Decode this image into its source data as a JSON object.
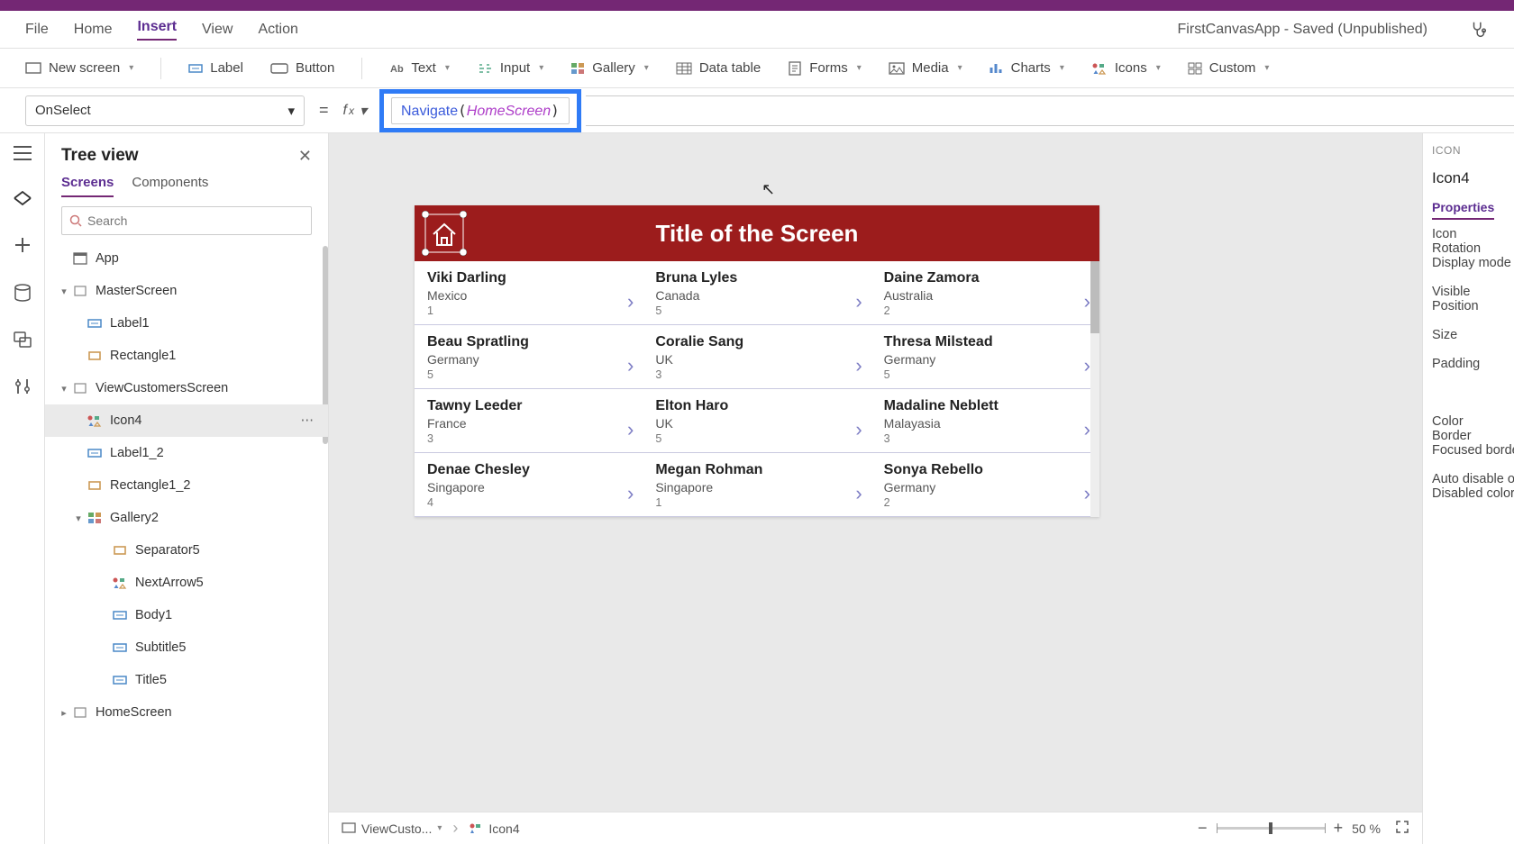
{
  "app_status": "FirstCanvasApp - Saved (Unpublished)",
  "menubar": {
    "items": [
      "File",
      "Home",
      "Insert",
      "View",
      "Action"
    ],
    "active_index": 2
  },
  "ribbon": {
    "groups": [
      {
        "label": "New screen",
        "has_chev": true,
        "icon": "screen"
      },
      {
        "sep": true
      },
      {
        "label": "Label",
        "icon": "label"
      },
      {
        "label": "Button",
        "icon": "button"
      },
      {
        "sep": true
      },
      {
        "label": "Text",
        "has_chev": true,
        "icon": "text"
      },
      {
        "label": "Input",
        "has_chev": true,
        "icon": "input"
      },
      {
        "label": "Gallery",
        "has_chev": true,
        "icon": "gallery"
      },
      {
        "label": "Data table",
        "icon": "datatable"
      },
      {
        "label": "Forms",
        "has_chev": true,
        "icon": "forms"
      },
      {
        "label": "Media",
        "has_chev": true,
        "icon": "media"
      },
      {
        "label": "Charts",
        "has_chev": true,
        "icon": "charts"
      },
      {
        "label": "Icons",
        "has_chev": true,
        "icon": "icons"
      },
      {
        "label": "Custom",
        "has_chev": true,
        "icon": "custom"
      }
    ]
  },
  "formula": {
    "property": "OnSelect",
    "fn": "Navigate",
    "arg": "HomeScreen"
  },
  "tree": {
    "title": "Tree view",
    "tabs": [
      "Screens",
      "Components"
    ],
    "active_tab": 0,
    "search_placeholder": "Search",
    "nodes": [
      {
        "indent": 0,
        "label": "App",
        "icon": "app",
        "twisty": ""
      },
      {
        "indent": 0,
        "label": "MasterScreen",
        "icon": "screen",
        "twisty": "▾",
        "check": true
      },
      {
        "indent": 1,
        "label": "Label1",
        "icon": "label"
      },
      {
        "indent": 1,
        "label": "Rectangle1",
        "icon": "rect"
      },
      {
        "indent": 0,
        "label": "ViewCustomersScreen",
        "icon": "screen",
        "twisty": "▾",
        "check": true
      },
      {
        "indent": 1,
        "label": "Icon4",
        "icon": "icons",
        "selected": true,
        "more": true
      },
      {
        "indent": 1,
        "label": "Label1_2",
        "icon": "label"
      },
      {
        "indent": 1,
        "label": "Rectangle1_2",
        "icon": "rect"
      },
      {
        "indent": 1,
        "label": "Gallery2",
        "icon": "gallery",
        "twisty": "▾"
      },
      {
        "indent": 2,
        "label": "Separator5",
        "icon": "rect"
      },
      {
        "indent": 2,
        "label": "NextArrow5",
        "icon": "icons"
      },
      {
        "indent": 2,
        "label": "Body1",
        "icon": "label"
      },
      {
        "indent": 2,
        "label": "Subtitle5",
        "icon": "label"
      },
      {
        "indent": 2,
        "label": "Title5",
        "icon": "label"
      },
      {
        "indent": 0,
        "label": "HomeScreen",
        "icon": "screen",
        "twisty": "▸",
        "check": true
      }
    ]
  },
  "canvas": {
    "screen_title": "Title of the Screen",
    "gallery": [
      [
        {
          "name": "Viki  Darling",
          "country": "Mexico",
          "n": "1"
        },
        {
          "name": "Bruna  Lyles",
          "country": "Canada",
          "n": "5"
        },
        {
          "name": "Daine  Zamora",
          "country": "Australia",
          "n": "2"
        }
      ],
      [
        {
          "name": "Beau  Spratling",
          "country": "Germany",
          "n": "5"
        },
        {
          "name": "Coralie  Sang",
          "country": "UK",
          "n": "3"
        },
        {
          "name": "Thresa  Milstead",
          "country": "Germany",
          "n": "5"
        }
      ],
      [
        {
          "name": "Tawny  Leeder",
          "country": "France",
          "n": "3"
        },
        {
          "name": "Elton  Haro",
          "country": "UK",
          "n": "5"
        },
        {
          "name": "Madaline  Neblett",
          "country": "Malayasia",
          "n": "3"
        }
      ],
      [
        {
          "name": "Denae  Chesley",
          "country": "Singapore",
          "n": "4"
        },
        {
          "name": "Megan  Rohman",
          "country": "Singapore",
          "n": "1"
        },
        {
          "name": "Sonya  Rebello",
          "country": "Germany",
          "n": "2"
        }
      ]
    ],
    "breadcrumb": {
      "screen": "ViewCusto...",
      "element": "Icon4"
    },
    "zoom": {
      "value": "50",
      "unit": "%"
    }
  },
  "properties": {
    "category": "ICON",
    "name": "Icon4",
    "tab": "Properties",
    "rows": [
      "Icon",
      "Rotation",
      "Display mode",
      "",
      "Visible",
      "Position",
      "",
      "Size",
      "",
      "Padding",
      "",
      "",
      "",
      "Color",
      "Border",
      "Focused border",
      "",
      "Auto disable on s",
      "Disabled color"
    ]
  }
}
